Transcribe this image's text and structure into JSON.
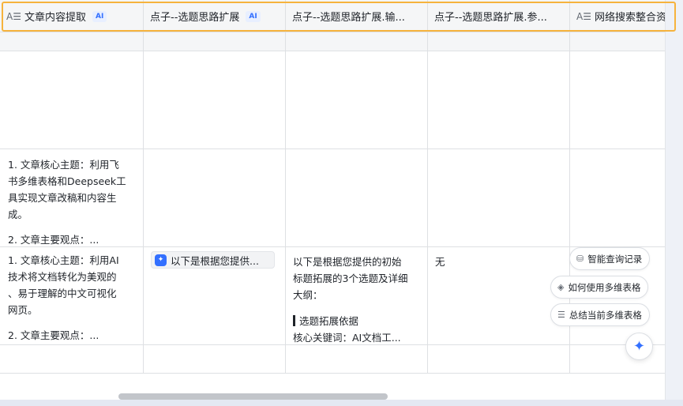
{
  "columns": [
    {
      "title": "文章内容提取",
      "type_icon": "text-field-icon",
      "ai": "AI"
    },
    {
      "title": "点子--选题思路扩展",
      "ai": "AI"
    },
    {
      "title": "点子--选题思路扩展.输..."
    },
    {
      "title": "点子--选题思路扩展.参..."
    },
    {
      "title": "网络搜索整合资",
      "type_icon": "text-field-icon"
    }
  ],
  "rows": [
    {
      "col1": ""
    },
    {
      "col1": [
        "1. 文章核心主题：利用飞",
        "书多维表格和Deepseek工",
        "具实现文章改稿和内容生",
        "成。",
        "",
        "2. 文章主要观点：..."
      ]
    },
    {
      "col1": [
        "1. 文章核心主题：利用AI",
        "技术将文档转化为美观的",
        "、易于理解的中文可视化",
        "网页。",
        "",
        "2. 文章主要观点：..."
      ],
      "col2_chip": "以下是根据您提供...",
      "col3": [
        "以下是根据您提供的初始",
        "标题拓展的3个选题及详细",
        "大纲："
      ],
      "col3_quote": "选题拓展依据",
      "col3_tail": "核心关键词：AI文档工...",
      "col4": "无"
    }
  ],
  "assistant": {
    "suggestions": [
      "智能查询记录",
      "如何使用多维表格",
      "总结当前多维表格"
    ],
    "fab_icon": "sparkle-icon"
  },
  "colors": {
    "accent": "#3370ff",
    "highlight": "#f6b33d"
  }
}
